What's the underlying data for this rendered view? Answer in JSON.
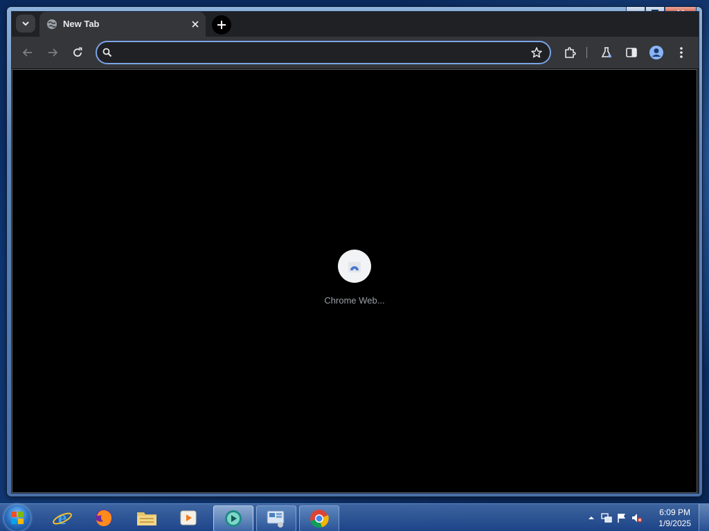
{
  "browser": {
    "tab": {
      "title": "New Tab"
    },
    "omnibox": {
      "value": "",
      "placeholder": ""
    },
    "shortcut": {
      "label": "Chrome Web..."
    }
  },
  "taskbar": {
    "clock": {
      "time": "6:09 PM",
      "date": "1/9/2025"
    },
    "apps": [
      "internet-explorer",
      "firefox",
      "file-explorer",
      "media-player",
      "app-open-1",
      "app-open-2",
      "chrome"
    ]
  },
  "colors": {
    "omnibox_border": "#7aa4e8",
    "tab_active": "#35363a",
    "content_bg": "#000000"
  }
}
